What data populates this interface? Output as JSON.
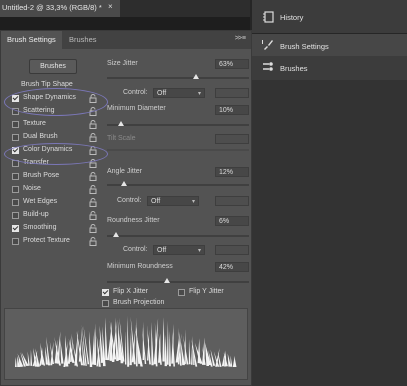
{
  "document": {
    "tab_title": "Untitled-2 @ 33,3% (RGB/8) *",
    "close_glyph": "×"
  },
  "panel": {
    "tabs": [
      {
        "label": "Brush Settings"
      },
      {
        "label": "Brushes"
      }
    ],
    "menu_glyph": ">> ≡",
    "brushes_button": "Brushes",
    "tip_shape": "Brush Tip Shape",
    "items": [
      {
        "label": "Shape Dynamics",
        "checked": true
      },
      {
        "label": "Scattering",
        "checked": false
      },
      {
        "label": "Texture",
        "checked": false
      },
      {
        "label": "Dual Brush",
        "checked": false
      },
      {
        "label": "Color Dynamics",
        "checked": true
      },
      {
        "label": "Transfer",
        "checked": false
      },
      {
        "label": "Brush Pose",
        "checked": false
      },
      {
        "label": "Noise",
        "checked": false
      },
      {
        "label": "Wet Edges",
        "checked": false
      },
      {
        "label": "Build-up",
        "checked": false
      },
      {
        "label": "Smoothing",
        "checked": true
      },
      {
        "label": "Protect Texture",
        "checked": false
      }
    ]
  },
  "settings": {
    "size_jitter": {
      "label": "Size Jitter",
      "value": "63%",
      "fraction": 0.63
    },
    "control1": {
      "label": "Control:",
      "value": "Off"
    },
    "min_diameter": {
      "label": "Minimum Diameter",
      "value": "10%",
      "fraction": 0.1
    },
    "tilt_scale": {
      "label": "Tilt Scale"
    },
    "angle_jitter": {
      "label": "Angle Jitter",
      "value": "12%",
      "fraction": 0.12
    },
    "control2": {
      "label": "Control:",
      "value": "Off"
    },
    "roundness_jitter": {
      "label": "Roundness Jitter",
      "value": "6%",
      "fraction": 0.06
    },
    "control3": {
      "label": "Control:",
      "value": "Off"
    },
    "min_roundness": {
      "label": "Minimum Roundness",
      "value": "42%",
      "fraction": 0.42
    },
    "flip_x": {
      "label": "Flip X Jitter",
      "checked": true
    },
    "flip_y": {
      "label": "Flip Y Jitter",
      "checked": false
    },
    "projection": {
      "label": "Brush Projection",
      "checked": false
    }
  },
  "right_panels": {
    "history": "History",
    "brush_settings": "Brush Settings",
    "brushes": "Brushes"
  },
  "colors": {
    "highlight_ellipse": "#7b77b8",
    "panel_bg": "#535353"
  }
}
